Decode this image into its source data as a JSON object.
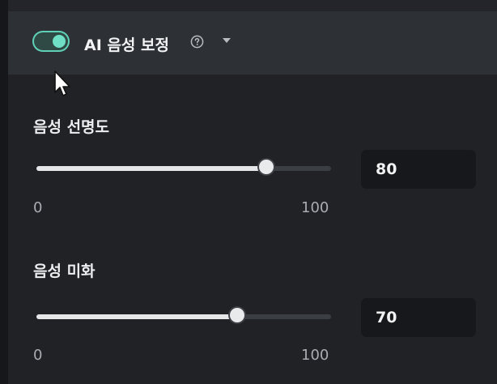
{
  "ai_voice_panel": {
    "toggle_on": true,
    "title": "AI 음성 보정",
    "help_icon": "question-circle-icon",
    "dropdown_icon": "caret-down-icon"
  },
  "voice_clarity": {
    "label": "음성 선명도",
    "value": "80",
    "fraction": 0.78,
    "min_label": "0",
    "max_label": "100"
  },
  "voice_beautify": {
    "label": "음성 미화",
    "value": "70",
    "fraction": 0.68,
    "min_label": "0",
    "max_label": "100"
  },
  "colors": {
    "accent": "#5fd0b6",
    "panel_bg": "#202226",
    "header_bg": "#2d3034",
    "input_bg": "#17181b"
  }
}
